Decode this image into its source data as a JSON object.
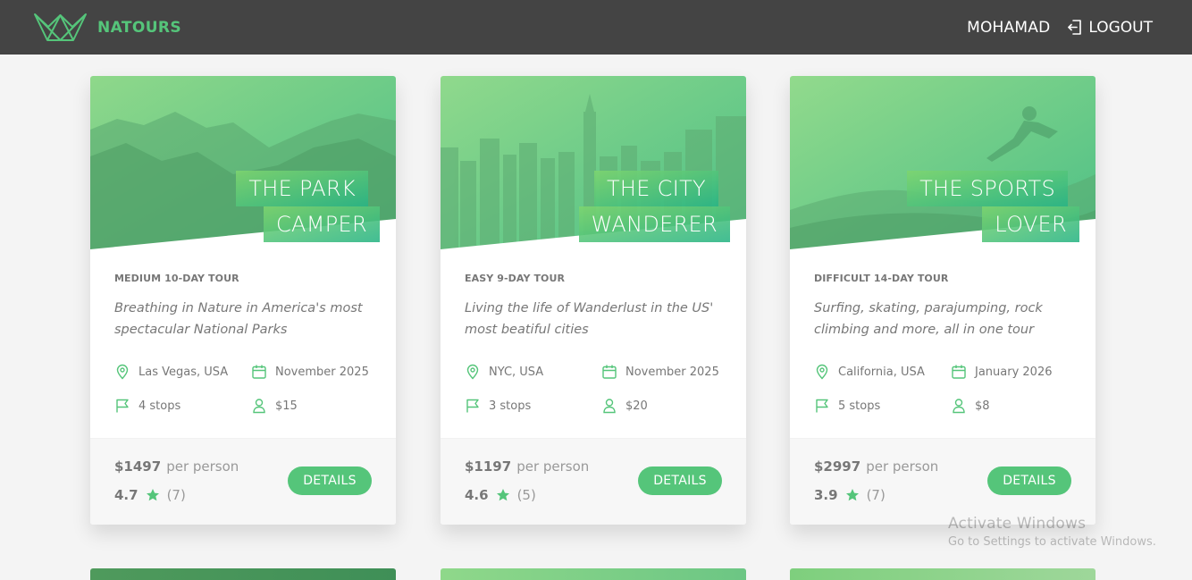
{
  "header": {
    "brand": "NATOURS",
    "user_name": "MOHAMAD",
    "logout_label": "LOGOUT",
    "logo_icon": "crown-logo-icon",
    "logout_icon": "logout-icon"
  },
  "colors": {
    "accent": "#55c57a",
    "header_bg": "#444444",
    "page_bg": "#f4f4f4"
  },
  "tours": [
    {
      "title_line1": "THE PARK",
      "title_line2": "CAMPER",
      "difficulty": "MEDIUM 10-DAY TOUR",
      "summary": "Breathing in Nature in America's most spectacular National Parks",
      "location": "Las Vegas, USA",
      "date": "November 2025",
      "stops": "4 stops",
      "group": "$15",
      "price": "$1497",
      "per_label": "per person",
      "rating_avg": "4.7",
      "rating_qty": "(7)",
      "button": "DETAILS"
    },
    {
      "title_line1": "THE CITY",
      "title_line2": "WANDERER",
      "difficulty": "EASY 9-DAY TOUR",
      "summary": "Living the life of Wanderlust in the US' most beatiful cities",
      "location": "NYC, USA",
      "date": "November 2025",
      "stops": "3 stops",
      "group": "$20",
      "price": "$1197",
      "per_label": "per person",
      "rating_avg": "4.6",
      "rating_qty": "(5)",
      "button": "DETAILS"
    },
    {
      "title_line1": "THE SPORTS",
      "title_line2": "LOVER",
      "difficulty": "DIFFICULT 14-DAY TOUR",
      "summary": "Surfing, skating, parajumping, rock climbing and more, all in one tour",
      "location": "California, USA",
      "date": "January 2026",
      "stops": "5 stops",
      "group": "$8",
      "price": "$2997",
      "per_label": "per person",
      "rating_avg": "3.9",
      "rating_qty": "(7)",
      "button": "DETAILS"
    }
  ],
  "watermark": {
    "title": "Activate Windows",
    "subtitle": "Go to Settings to activate Windows."
  }
}
